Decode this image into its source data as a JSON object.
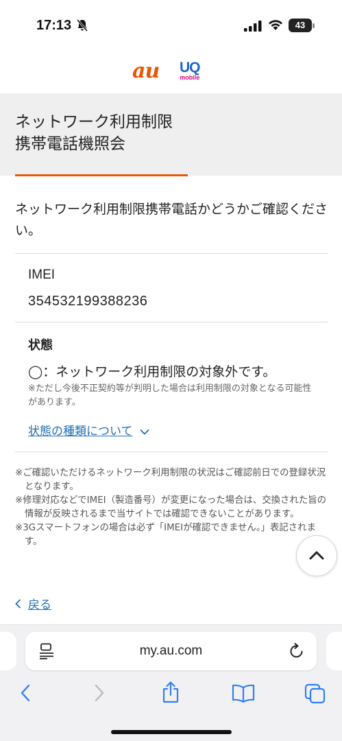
{
  "status_bar": {
    "time": "17:13",
    "battery": "43"
  },
  "logos": {
    "au": "au",
    "uq": "UQ",
    "uq_sub": "mobile"
  },
  "page": {
    "title_line1": "ネットワーク利用制限",
    "title_line2": "携帯電話機照会",
    "intro": "ネットワーク利用制限携帯電話かどうかご確認ください。"
  },
  "imei": {
    "label": "IMEI",
    "value": "354532199388236"
  },
  "status": {
    "label": "状態",
    "result": "◯：ネットワーク利用制限の対象外です。",
    "note": "※ただし今後不正契約等が判明した場合は利用制限の対象となる可能性があります。",
    "link": "状態の種類について"
  },
  "notes": [
    "※ご確認いただけるネットワーク利用制限の状況はご確認前日での登録状況となります。",
    "※修理対応などでIMEI（製造番号）が変更になった場合は、交換された旨の情報が反映されるまで当サイトでは確認できないことがあります。",
    "※3Gスマートフォンの場合は必ず「IMEIが確認できません。」表記されます。"
  ],
  "back_link": "戻る",
  "browser": {
    "url": "my.au.com"
  },
  "colors": {
    "accent_orange": "#eb5505",
    "link_blue": "#1f6fb5",
    "uq_blue": "#1e64c8",
    "uq_pink": "#e6007e",
    "ios_blue": "#2f7ff5"
  },
  "icons": {
    "status": [
      "bell-slash-icon",
      "signal-icon",
      "wifi-icon",
      "battery-icon"
    ],
    "toolbar": [
      "back-icon",
      "forward-icon",
      "share-icon",
      "bookmarks-icon",
      "tabs-icon"
    ]
  }
}
